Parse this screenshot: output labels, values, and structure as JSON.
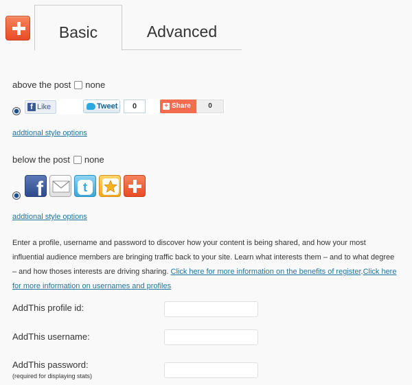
{
  "tabs": [
    {
      "label": "Basic",
      "active": true
    },
    {
      "label": "Advanced",
      "active": false
    }
  ],
  "above_post": {
    "label": "above the post",
    "none_label": "none",
    "buttons": {
      "like_label": "Like",
      "tweet_label": "Tweet",
      "tweet_count": "0",
      "share_label": "Share",
      "share_count": "0"
    },
    "style_link": "addtional style options"
  },
  "below_post": {
    "label": "below the post",
    "none_label": "none",
    "icons": [
      "facebook-icon",
      "email-icon",
      "twitter-icon",
      "favorites-icon",
      "addthis-icon"
    ],
    "style_link": "addtional style options"
  },
  "description": {
    "text": "Enter a profile, username and password to discover how your content is being shared, and how your most influential audience members are bringing traffic back to your site. Learn what interests them – and to what degree – and how thoses interests are driving sharing. ",
    "link1": "Click here for more information on the benefits of register",
    "link2": "Click here for more information on usernames and profiles"
  },
  "fields": {
    "profile_label": "AddThis profile id:",
    "profile_value": "",
    "username_label": "AddThis username:",
    "username_value": "",
    "password_label": "AddThis password:",
    "password_note": "(required for displaying stats)",
    "password_value": ""
  },
  "colors": {
    "accent": "#e94b25",
    "link": "#21759b"
  }
}
